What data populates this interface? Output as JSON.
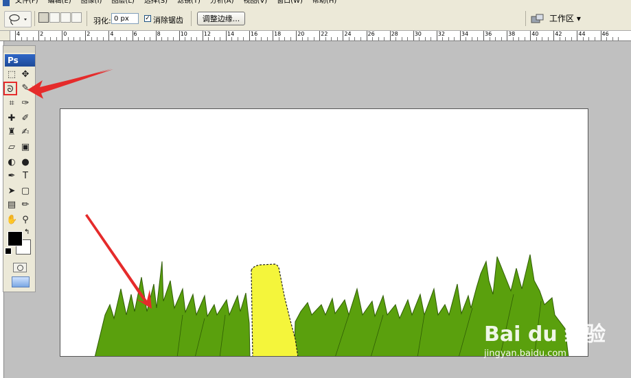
{
  "menu": {
    "items": [
      "文件(F)",
      "编辑(E)",
      "图像(I)",
      "图层(L)",
      "选择(S)",
      "滤镜(T)",
      "分析(A)",
      "视图(V)",
      "窗口(W)",
      "帮助(H)"
    ]
  },
  "options": {
    "feather_label": "羽化:",
    "feather_value": "0 px",
    "antialias_checked": "✓",
    "antialias_label": "消除锯齿",
    "refine_edge_label": "调整边缘...",
    "workspace_label": "工作区 ▾"
  },
  "ruler": {
    "labels": [
      "4",
      "2",
      "0",
      "2",
      "4",
      "6",
      "8",
      "10",
      "12",
      "14",
      "16",
      "18",
      "20",
      "22",
      "24",
      "26",
      "28",
      "30",
      "32",
      "34",
      "36",
      "38",
      "40",
      "42",
      "44",
      "46"
    ]
  },
  "toolbox": {
    "logo": "Ps",
    "tools": [
      {
        "name": "marquee-tool",
        "glyph": "⬚"
      },
      {
        "name": "move-tool",
        "glyph": "✥"
      },
      {
        "name": "lasso-tool",
        "glyph": "ᘐ"
      },
      {
        "name": "magic-wand-tool",
        "glyph": "✎"
      },
      {
        "name": "crop-tool",
        "glyph": "⌗"
      },
      {
        "name": "slice-tool",
        "glyph": "✑"
      },
      {
        "name": "healing-brush-tool",
        "glyph": "✚"
      },
      {
        "name": "brush-tool",
        "glyph": "✐"
      },
      {
        "name": "clone-stamp-tool",
        "glyph": "♜"
      },
      {
        "name": "history-brush-tool",
        "glyph": "✍"
      },
      {
        "name": "eraser-tool",
        "glyph": "▱"
      },
      {
        "name": "gradient-tool",
        "glyph": "▣"
      },
      {
        "name": "blur-tool",
        "glyph": "◐"
      },
      {
        "name": "dodge-tool",
        "glyph": "●"
      },
      {
        "name": "pen-tool",
        "glyph": "✒"
      },
      {
        "name": "type-tool",
        "glyph": "T"
      },
      {
        "name": "path-selection-tool",
        "glyph": "➤"
      },
      {
        "name": "shape-tool",
        "glyph": "▢"
      },
      {
        "name": "notes-tool",
        "glyph": "▤"
      },
      {
        "name": "eyedropper-tool",
        "glyph": "✏"
      },
      {
        "name": "hand-tool",
        "glyph": "✋"
      },
      {
        "name": "zoom-tool",
        "glyph": "⚲"
      }
    ]
  },
  "colors": {
    "grass": "#5aa00d",
    "grass_dark": "#2f5c05",
    "selection_fill": "#f4f53b",
    "arrow": "#e52b2b",
    "app_bg": "#c0c0c0"
  },
  "watermark": {
    "brand": "Bai du 经验",
    "url": "jingyan.baidu.com"
  }
}
